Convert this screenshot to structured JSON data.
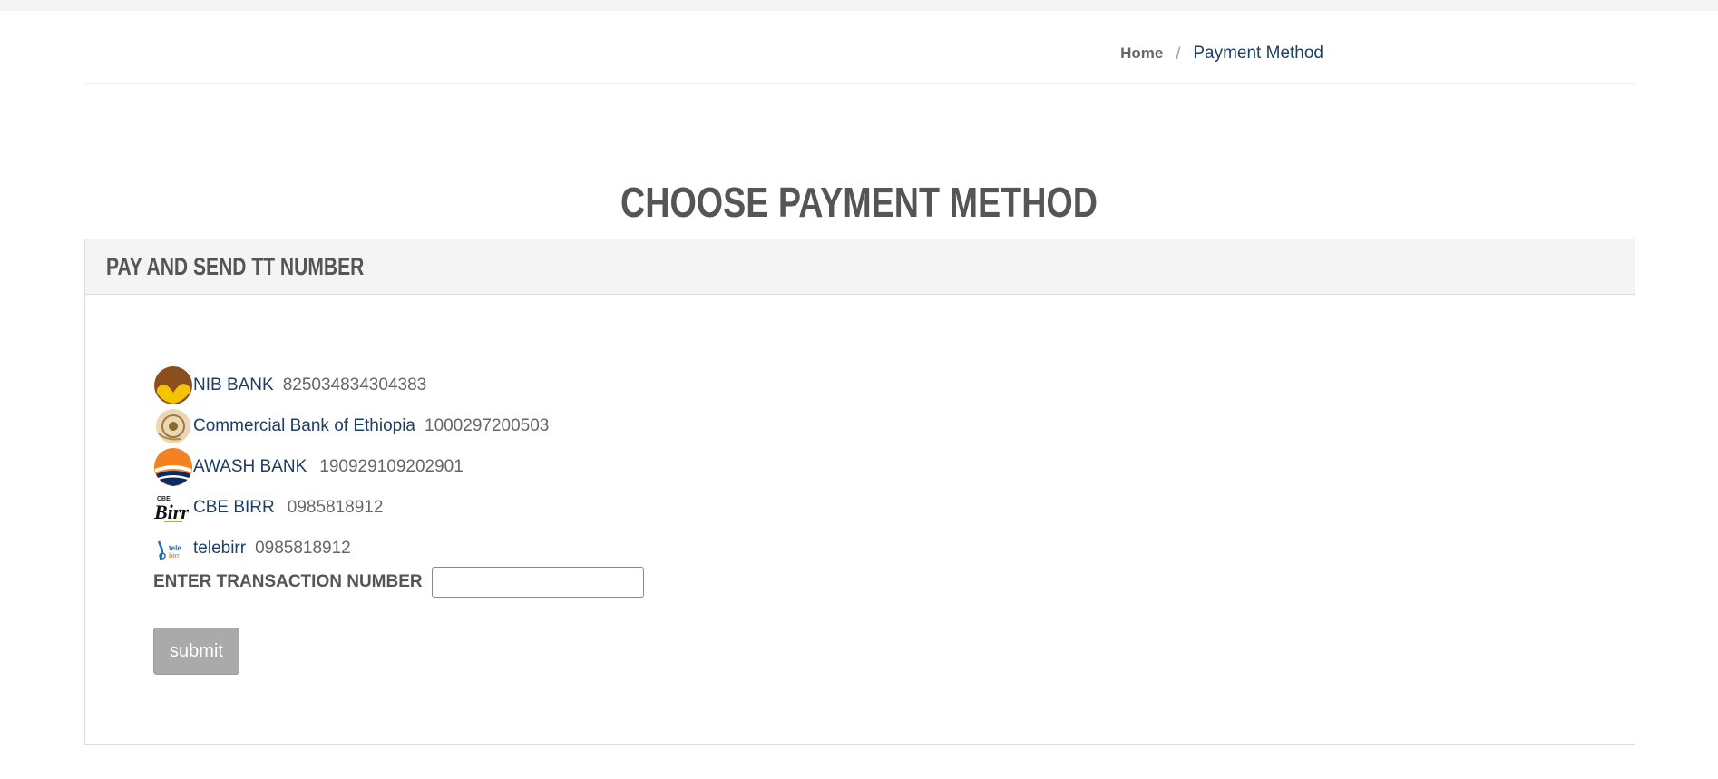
{
  "breadcrumb": {
    "home": "Home",
    "separator": "/",
    "current": "Payment Method"
  },
  "page_title": "CHOOSE PAYMENT METHOD",
  "panel": {
    "heading": "PAY AND SEND TT NUMBER",
    "methods": [
      {
        "name": "NIB BANK",
        "account": "825034834304383",
        "icon": "nib-bank-logo"
      },
      {
        "name": "Commercial Bank of Ethiopia",
        "account": "1000297200503",
        "icon": "cbe-logo"
      },
      {
        "name": "AWASH BANK",
        "account": "190929109202901",
        "icon": "awash-bank-logo"
      },
      {
        "name": "CBE BIRR",
        "account": "0985818912",
        "icon": "cbe-birr-logo"
      },
      {
        "name": "telebirr",
        "account": "0985818912",
        "icon": "telebirr-logo"
      }
    ],
    "transaction_label": "ENTER TRANSACTION NUMBER",
    "transaction_value": "",
    "submit_label": "submit"
  },
  "colors": {
    "link": "#1d3f66",
    "text": "#555555",
    "button": "#aaaaaa",
    "panel_heading_bg": "#f4f4f4"
  }
}
